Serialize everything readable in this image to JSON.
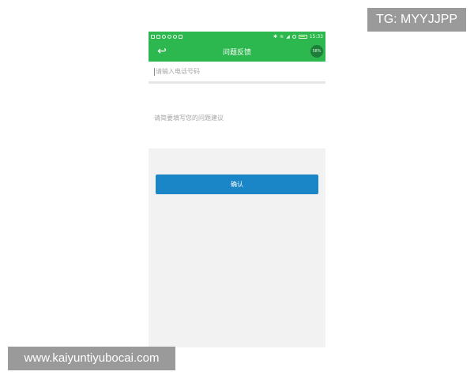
{
  "watermarks": {
    "tg": "TG: MYYJJPP",
    "url": "www.kaiyuntiyubocai.com"
  },
  "statusbar": {
    "time": "15:33",
    "left_icons": [
      "notification-icon",
      "image-icon",
      "shield-icon",
      "download-icon",
      "chat-icon",
      "gallery-icon"
    ],
    "right_icons": [
      "bluetooth-icon",
      "wifi-icon",
      "signal-icon",
      "alarm-icon",
      "battery-icon"
    ]
  },
  "header": {
    "title": "问题反馈",
    "back_icon": "back-arrow-icon",
    "badge": "58%"
  },
  "form": {
    "phone_placeholder": "请输入电话号码",
    "suggestion_placeholder": "请简要填写您的问题建议",
    "submit_label": "确认"
  },
  "colors": {
    "brand_green": "#2db84f",
    "button_blue": "#1a86c8",
    "page_bg": "#f2f2f2"
  }
}
